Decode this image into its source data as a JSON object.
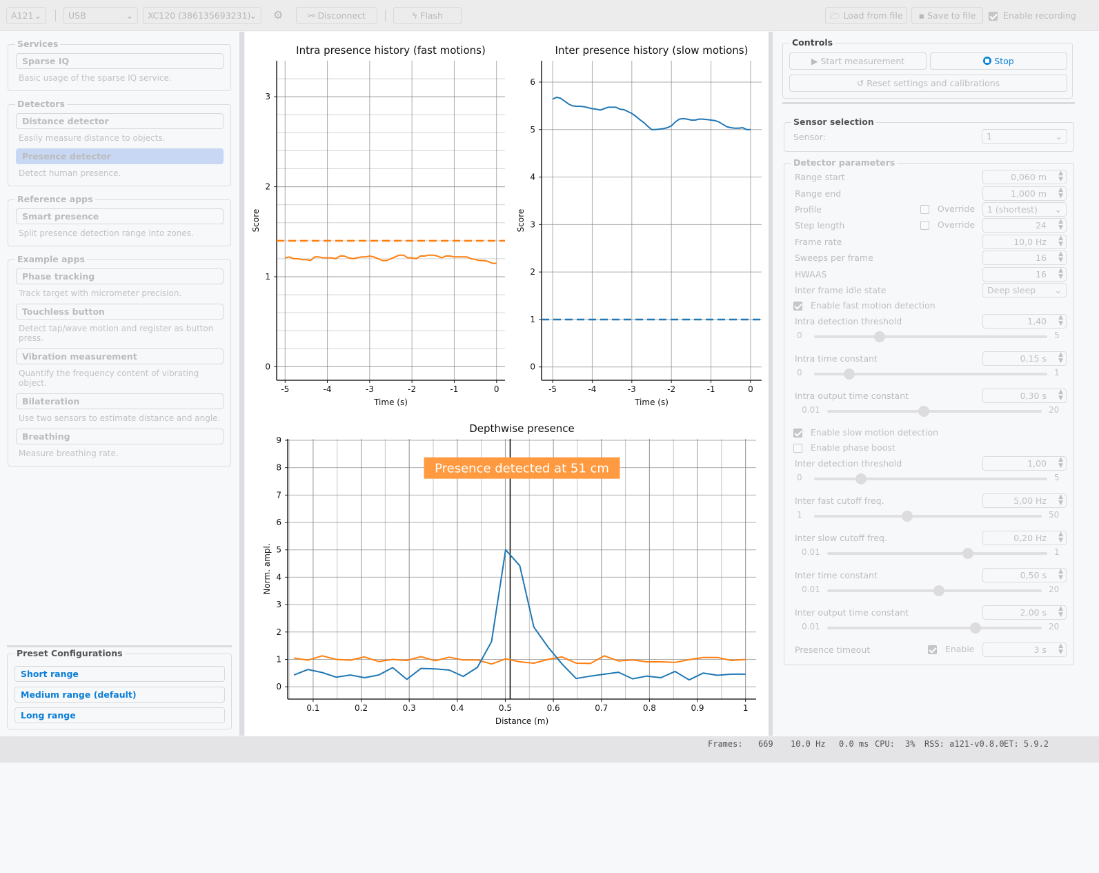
{
  "toolbar": {
    "generation": "A121",
    "port": "USB",
    "device": "XC120 (386135693231)",
    "disconnect_label": "Disconnect",
    "flash_label": "Flash",
    "load_label": "Load from file",
    "save_label": "Save to file",
    "recording_label": "Enable recording",
    "recording_checked": true
  },
  "sidebar": {
    "groups": [
      {
        "title": "Services",
        "apps": [
          {
            "label": "Sparse IQ",
            "desc": "Basic usage of the sparse IQ service."
          }
        ]
      },
      {
        "title": "Detectors",
        "apps": [
          {
            "label": "Distance detector",
            "desc": "Easily measure distance to objects."
          },
          {
            "label": "Presence detector",
            "desc": "Detect human presence.",
            "selected": true
          }
        ]
      },
      {
        "title": "Reference apps",
        "apps": [
          {
            "label": "Smart presence",
            "desc": "Split presence detection range into zones."
          }
        ]
      },
      {
        "title": "Example apps",
        "apps": [
          {
            "label": "Phase tracking",
            "desc": "Track target with micrometer precision."
          },
          {
            "label": "Touchless button",
            "desc": "Detect tap/wave motion and register as button press."
          },
          {
            "label": "Vibration measurement",
            "desc": "Quantify the frequency content of vibrating object."
          },
          {
            "label": "Bilateration",
            "desc": "Use two sensors to estimate distance and angle."
          },
          {
            "label": "Breathing",
            "desc": "Measure breathing rate."
          }
        ]
      }
    ],
    "presets": {
      "title": "Preset Configurations",
      "items": [
        "Short range",
        "Medium range (default)",
        "Long range"
      ]
    }
  },
  "controls": {
    "title": "Controls",
    "start_label": "Start measurement",
    "stop_label": "Stop",
    "reset_label": "Reset settings and calibrations"
  },
  "sensor_selection": {
    "title": "Sensor selection",
    "label": "Sensor:",
    "value": "1"
  },
  "detector_params": {
    "title": "Detector parameters",
    "range_start": {
      "label": "Range start",
      "value": "0,060  m"
    },
    "range_end": {
      "label": "Range end",
      "value": "1,000  m"
    },
    "profile": {
      "label": "Profile",
      "override_label": "Override",
      "value": "1 (shortest)"
    },
    "step_length": {
      "label": "Step length",
      "override_label": "Override",
      "value": "24"
    },
    "frame_rate": {
      "label": "Frame rate",
      "value": "10,0  Hz"
    },
    "sweeps_per_frame": {
      "label": "Sweeps per frame",
      "value": "16"
    },
    "hwaas": {
      "label": "HWAAS",
      "value": "16"
    },
    "idle_state": {
      "label": "Inter frame idle state",
      "value": "Deep sleep"
    },
    "enable_fast": {
      "label": "Enable fast motion detection",
      "checked": true
    },
    "intra_threshold": {
      "label": "Intra detection threshold",
      "value": "1,40",
      "min": "0",
      "max": "5",
      "slider_fraction": 0.28
    },
    "intra_tc": {
      "label": "Intra time constant",
      "value": "0,15  s",
      "min": "0",
      "max": "1",
      "slider_fraction": 0.15
    },
    "intra_out_tc": {
      "label": "Intra output time constant",
      "value": "0,30  s",
      "min": "0.01",
      "max": "20",
      "slider_fraction": 0.45
    },
    "enable_slow": {
      "label": "Enable slow motion detection",
      "checked": true
    },
    "enable_phase_boost": {
      "label": "Enable phase boost",
      "checked": false
    },
    "inter_threshold": {
      "label": "Inter detection threshold",
      "value": "1,00",
      "min": "0",
      "max": "5",
      "slider_fraction": 0.2
    },
    "inter_fast_cutoff": {
      "label": "Inter fast cutoff freq.",
      "value": "5,00  Hz",
      "min": "1",
      "max": "50",
      "slider_fraction": 0.41
    },
    "inter_slow_cutoff": {
      "label": "Inter slow cutoff freq.",
      "value": "0,20  Hz",
      "min": "0.01",
      "max": "1",
      "slider_fraction": 0.64
    },
    "inter_tc": {
      "label": "Inter time constant",
      "value": "0,50  s",
      "min": "0.01",
      "max": "20",
      "slider_fraction": 0.52
    },
    "inter_out_tc": {
      "label": "Inter output time constant",
      "value": "2,00  s",
      "min": "0.01",
      "max": "20",
      "slider_fraction": 0.69
    },
    "presence_timeout": {
      "label": "Presence timeout",
      "enable_label": "Enable",
      "checked": true,
      "value": "3  s"
    }
  },
  "status": {
    "frames_label": "Frames:",
    "frames": "669",
    "rate": "10.0 Hz",
    "latency": "0.0 ms",
    "cpu_label": "CPU:",
    "cpu": "3%",
    "rss": "RSS: a121-v0.8.0",
    "et": "ET: 5.9.2"
  },
  "colors": {
    "orange": "#ff7f0e",
    "blue": "#1f77b4",
    "accent": "#0a84d8",
    "annotation_bg": "#ff9a40"
  },
  "chart_data": [
    {
      "type": "line",
      "title": "Intra presence history (fast motions)",
      "xlabel": "Time (s)",
      "ylabel": "Score",
      "xlim": [
        -5.2,
        0.2
      ],
      "ylim": [
        -0.15,
        3.4
      ],
      "xticks": [
        -5,
        -4,
        -3,
        -2,
        -1,
        0
      ],
      "yticks": [
        0,
        1,
        2,
        3
      ],
      "grid": true,
      "threshold": 1.4,
      "series": [
        {
          "name": "intra",
          "color": "orange",
          "x": [
            -5.0,
            -4.9,
            -4.8,
            -4.7,
            -4.6,
            -4.5,
            -4.4,
            -4.3,
            -4.2,
            -4.1,
            -4.0,
            -3.9,
            -3.8,
            -3.7,
            -3.6,
            -3.5,
            -3.4,
            -3.3,
            -3.2,
            -3.1,
            -3.0,
            -2.9,
            -2.8,
            -2.7,
            -2.6,
            -2.5,
            -2.4,
            -2.3,
            -2.2,
            -2.1,
            -2.0,
            -1.9,
            -1.8,
            -1.7,
            -1.6,
            -1.5,
            -1.4,
            -1.3,
            -1.2,
            -1.1,
            -1.0,
            -0.9,
            -0.8,
            -0.7,
            -0.6,
            -0.5,
            -0.4,
            -0.3,
            -0.2,
            -0.1,
            0.0
          ],
          "values": [
            1.21,
            1.22,
            1.2,
            1.2,
            1.19,
            1.19,
            1.18,
            1.22,
            1.22,
            1.21,
            1.21,
            1.21,
            1.2,
            1.23,
            1.23,
            1.21,
            1.2,
            1.21,
            1.22,
            1.22,
            1.23,
            1.22,
            1.2,
            1.18,
            1.18,
            1.2,
            1.22,
            1.24,
            1.24,
            1.21,
            1.21,
            1.2,
            1.23,
            1.23,
            1.24,
            1.24,
            1.23,
            1.21,
            1.23,
            1.23,
            1.22,
            1.22,
            1.22,
            1.22,
            1.2,
            1.19,
            1.18,
            1.18,
            1.17,
            1.15,
            1.15
          ]
        }
      ]
    },
    {
      "type": "line",
      "title": "Inter presence history (slow motions)",
      "xlabel": "Time (s)",
      "ylabel": "Score",
      "xlim": [
        -5.28,
        0.28
      ],
      "ylim": [
        -0.28,
        6.45
      ],
      "xticks": [
        -5,
        -4,
        -3,
        -2,
        -1,
        0
      ],
      "yticks": [
        0,
        1,
        2,
        3,
        4,
        5,
        6
      ],
      "grid": true,
      "threshold": 1.0,
      "series": [
        {
          "name": "inter",
          "color": "blue",
          "x": [
            -5.0,
            -4.9,
            -4.8,
            -4.7,
            -4.6,
            -4.5,
            -4.4,
            -4.3,
            -4.2,
            -4.1,
            -4.0,
            -3.9,
            -3.8,
            -3.7,
            -3.6,
            -3.5,
            -3.4,
            -3.3,
            -3.2,
            -3.1,
            -3.0,
            -2.9,
            -2.8,
            -2.7,
            -2.6,
            -2.5,
            -2.4,
            -2.3,
            -2.2,
            -2.1,
            -2.0,
            -1.9,
            -1.8,
            -1.7,
            -1.6,
            -1.5,
            -1.4,
            -1.3,
            -1.2,
            -1.1,
            -1.0,
            -0.9,
            -0.8,
            -0.7,
            -0.6,
            -0.5,
            -0.4,
            -0.3,
            -0.2,
            -0.1,
            0.0
          ],
          "values": [
            5.64,
            5.68,
            5.66,
            5.6,
            5.54,
            5.5,
            5.49,
            5.49,
            5.48,
            5.46,
            5.44,
            5.43,
            5.41,
            5.44,
            5.47,
            5.47,
            5.47,
            5.43,
            5.42,
            5.38,
            5.34,
            5.28,
            5.21,
            5.15,
            5.07,
            5.0,
            5.0,
            5.01,
            5.02,
            5.04,
            5.08,
            5.16,
            5.22,
            5.23,
            5.22,
            5.2,
            5.2,
            5.22,
            5.22,
            5.21,
            5.2,
            5.19,
            5.16,
            5.11,
            5.06,
            5.04,
            5.03,
            5.03,
            5.04,
            5.0,
            5.0
          ]
        }
      ]
    },
    {
      "type": "line",
      "title": "Depthwise presence",
      "xlabel": "Distance (m)",
      "ylabel": "Norm. ampl.",
      "xlim": [
        0.047,
        1.022
      ],
      "ylim": [
        -0.45,
        9.05
      ],
      "xticks": [
        0.1,
        0.2,
        0.3,
        0.4,
        0.5,
        0.6,
        0.7,
        0.8,
        0.9,
        1
      ],
      "xtick_labels": [
        "0.1",
        "0.2",
        "0.3",
        "0.4",
        "0.5",
        "0.6",
        "0.7",
        "0.8",
        "0.9",
        "1"
      ],
      "yticks": [
        0,
        1,
        2,
        3,
        4,
        5,
        6,
        7,
        8,
        9
      ],
      "grid": true,
      "vline": 0.51,
      "annotation": "Presence detected at 51 cm",
      "x": [
        0.06,
        0.0894,
        0.1188,
        0.1481,
        0.1775,
        0.2069,
        0.2363,
        0.2656,
        0.295,
        0.3244,
        0.3538,
        0.3831,
        0.4125,
        0.4419,
        0.4713,
        0.5006,
        0.53,
        0.5594,
        0.5888,
        0.6181,
        0.6475,
        0.6769,
        0.7063,
        0.7356,
        0.765,
        0.7944,
        0.8238,
        0.8531,
        0.8825,
        0.9119,
        0.9413,
        0.9706,
        1.0
      ],
      "series": [
        {
          "name": "fast",
          "color": "orange",
          "values": [
            1.05,
            0.97,
            1.13,
            1.0,
            0.97,
            1.09,
            0.92,
            1.0,
            0.96,
            1.1,
            0.95,
            1.08,
            0.98,
            0.98,
            0.83,
            1.02,
            0.91,
            0.86,
            1.0,
            1.09,
            0.86,
            0.85,
            1.13,
            0.94,
            0.98,
            0.91,
            0.91,
            0.89,
            0.99,
            1.07,
            1.07,
            0.96,
            1.0
          ]
        },
        {
          "name": "slow",
          "color": "blue",
          "values": [
            0.43,
            0.63,
            0.52,
            0.35,
            0.43,
            0.33,
            0.43,
            0.7,
            0.27,
            0.67,
            0.65,
            0.61,
            0.38,
            0.71,
            1.65,
            5.0,
            4.42,
            2.18,
            1.45,
            0.83,
            0.3,
            0.39,
            0.46,
            0.53,
            0.29,
            0.39,
            0.33,
            0.56,
            0.25,
            0.5,
            0.42,
            0.46,
            0.46
          ]
        }
      ]
    }
  ]
}
